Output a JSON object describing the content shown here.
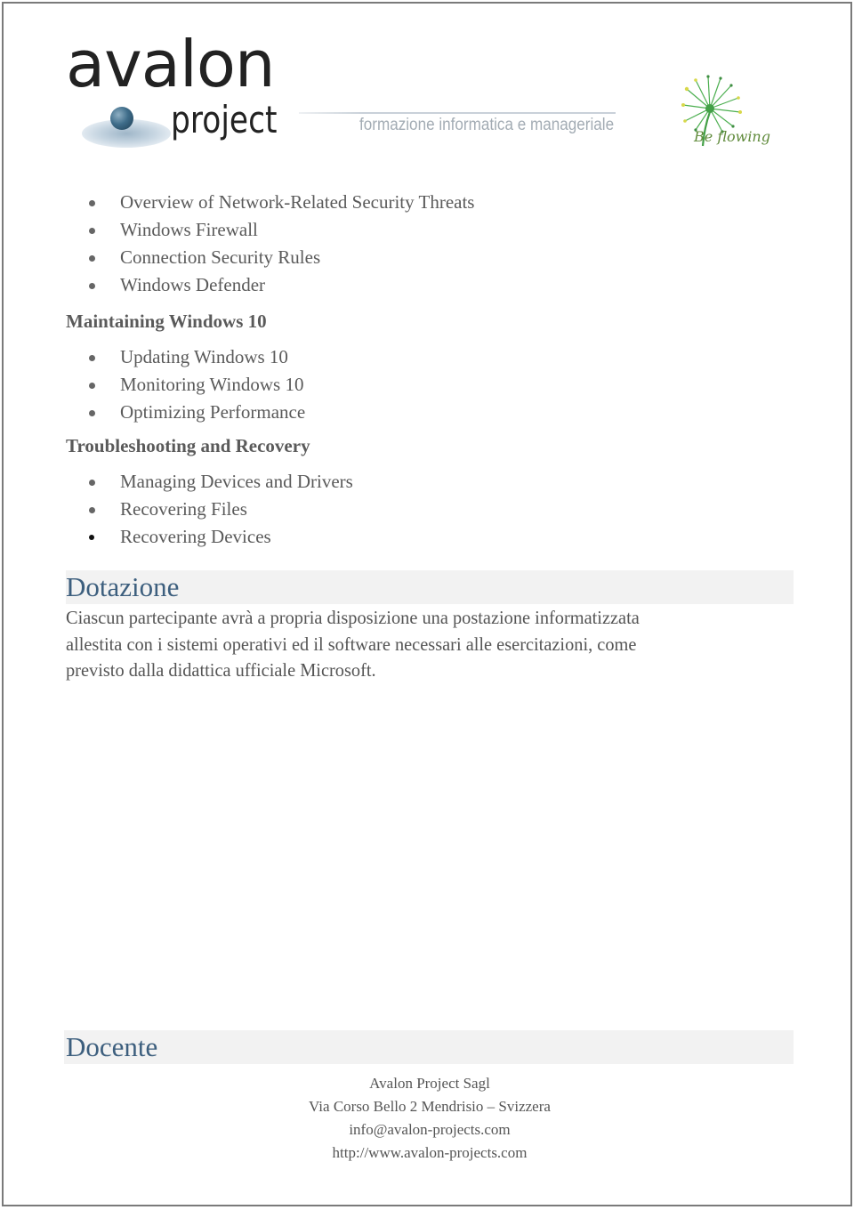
{
  "header": {
    "logo_word": "avalon",
    "logo_sub": "project",
    "tagline": "formazione informatica e manageriale",
    "partner_logo_text": "Be flowing"
  },
  "sections": [
    {
      "title": null,
      "items": [
        "Overview of Network-Related Security Threats",
        "Windows Firewall",
        "Connection Security Rules",
        "Windows Defender"
      ]
    },
    {
      "title": "Maintaining Windows 10",
      "items": [
        "Updating Windows 10",
        "Monitoring Windows 10",
        "Optimizing Performance"
      ]
    },
    {
      "title": "Troubleshooting and Recovery",
      "items": [
        "Managing Devices and Drivers",
        "Recovering Files",
        "Recovering Devices"
      ]
    }
  ],
  "dotazione": {
    "title": "Dotazione",
    "lines": [
      "Ciascun partecipante avrà a propria disposizione una postazione informatizzata",
      "allestita con i sistemi operativi ed il software necessari alle esercitazioni, come",
      "previsto dalla didattica ufficiale Microsoft."
    ]
  },
  "docente": {
    "title": "Docente",
    "company": "Avalon Project Sagl",
    "address": "Via Corso Bello 2 Mendrisio – Svizzera",
    "email": "info@avalon-projects.com",
    "website": "http://www.avalon-projects.com"
  },
  "colors": {
    "heading_blue": "#3d5f7e",
    "band_gray": "#f2f2f2",
    "text_gray": "#555555"
  }
}
